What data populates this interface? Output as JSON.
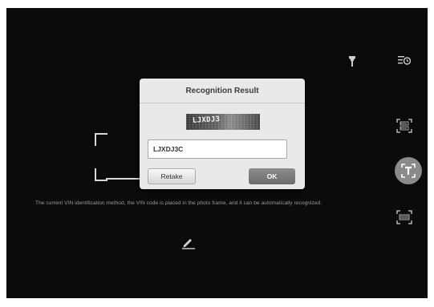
{
  "dialog": {
    "title": "Recognition Result",
    "snapshot_text": "LJXDJ3",
    "vin_value": "LJXDJ3C",
    "retake_label": "Retake",
    "ok_label": "OK"
  },
  "hint": "The current VIN identification method, the VIN code is placed in the photo frame, and it can be automatically recognized.",
  "icons": {
    "flash": "flashlight-icon",
    "history": "history-icon",
    "scan_vin": "scan-vin-icon",
    "text_mode": "text-recognition-icon",
    "scan_barcode": "scan-barcode-icon",
    "edit": "edit-pencil-icon"
  },
  "colors": {
    "background": "#0b0b0b",
    "dialog": "#e9e9e9",
    "ok_button": "#7a7a7a"
  }
}
